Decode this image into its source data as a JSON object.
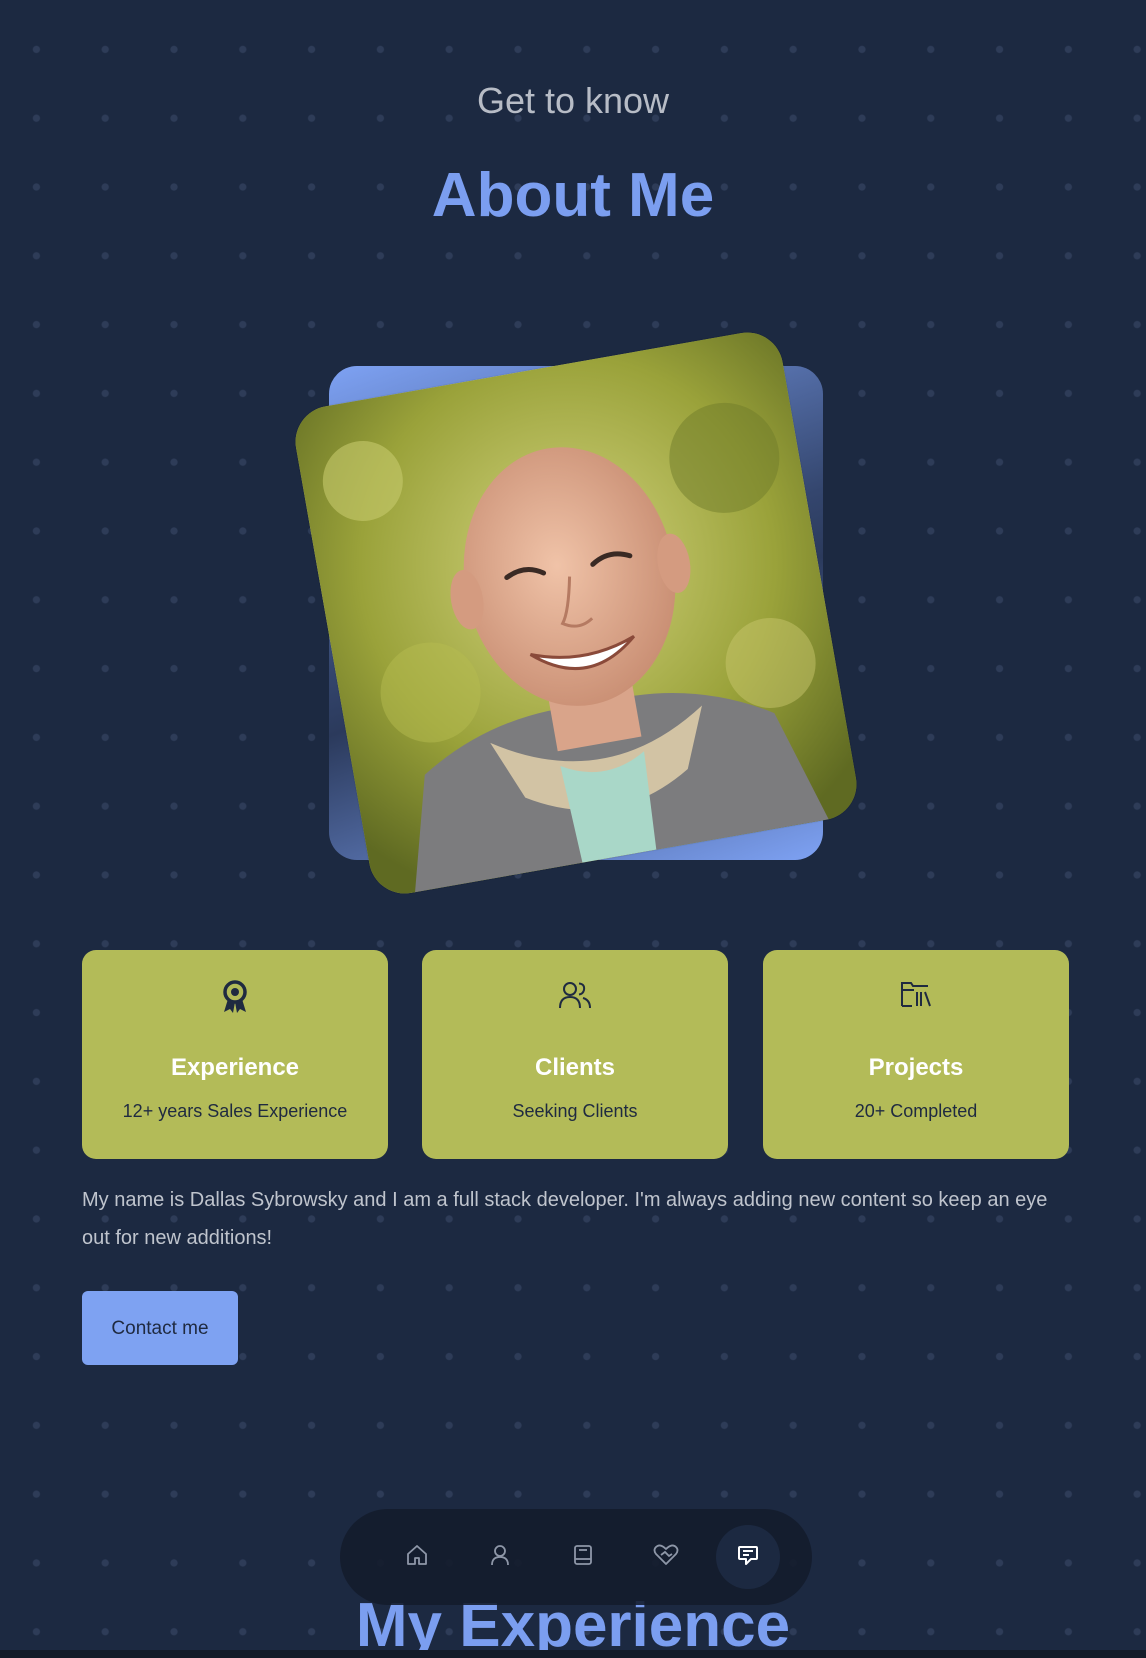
{
  "header": {
    "subtitle": "Get to know",
    "title": "About Me"
  },
  "profile_photo": {
    "alt": "Dallas Sybrowsky"
  },
  "cards": [
    {
      "icon": "award-icon",
      "title": "Experience",
      "value": "12+ years Sales Experience"
    },
    {
      "icon": "users-icon",
      "title": "Clients",
      "value": "Seeking Clients"
    },
    {
      "icon": "folder-library-icon",
      "title": "Projects",
      "value": "20+ Completed"
    }
  ],
  "bio": "My name is Dallas Sybrowsky and I am a full stack developer. I'm always adding new content so keep an eye out for new additions!",
  "contact_button": "Contact me",
  "next_section_title": "My Experience",
  "nav": {
    "items": [
      {
        "icon": "home-icon",
        "active": false
      },
      {
        "icon": "user-icon",
        "active": false
      },
      {
        "icon": "book-icon",
        "active": false
      },
      {
        "icon": "handshake-heart-icon",
        "active": false
      },
      {
        "icon": "message-icon",
        "active": true
      }
    ]
  },
  "colors": {
    "background": "#1c2941",
    "accent": "#7b9ef0",
    "card": "#b3bb58",
    "subtitle": "#b7bcc6"
  }
}
